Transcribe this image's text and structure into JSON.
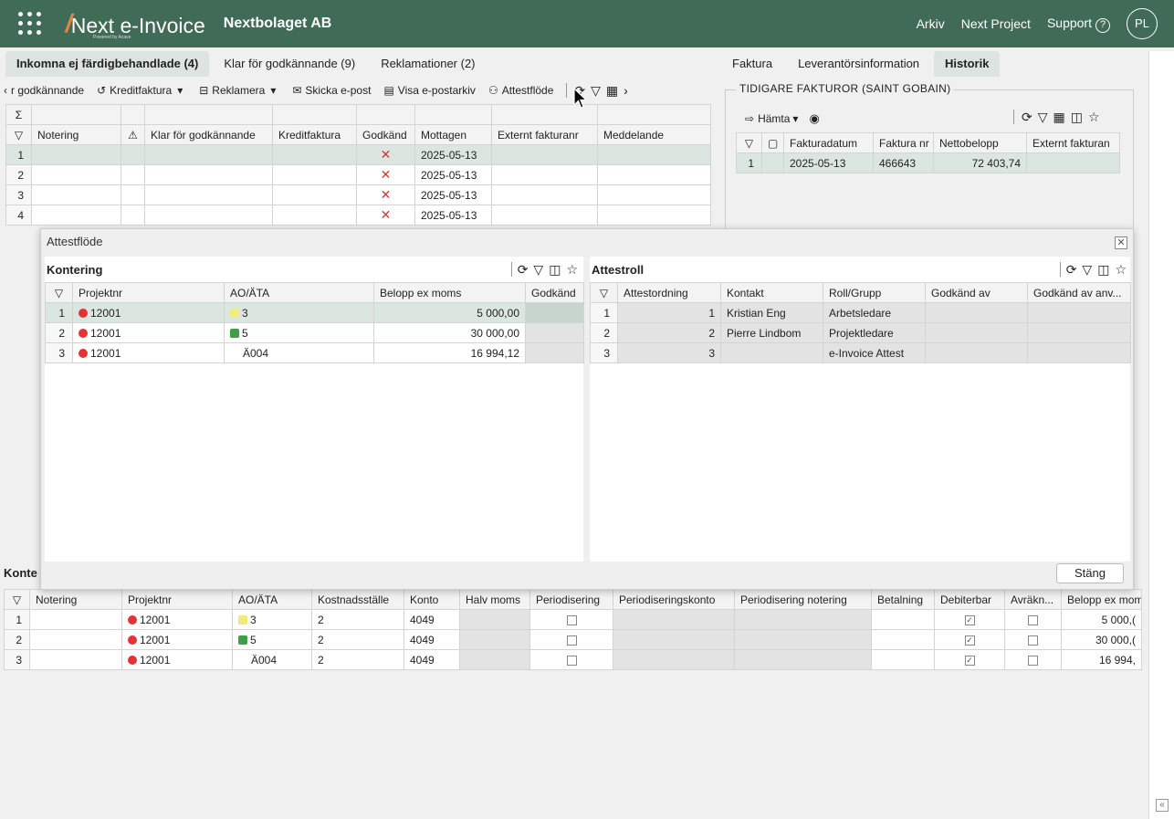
{
  "header": {
    "brand": "Next e-Invoice",
    "powered": "Powered by Acave",
    "company": "Nextbolaget AB",
    "links": [
      "Arkiv",
      "Next Project",
      "Support"
    ],
    "avatar": "PL"
  },
  "left_tabs": [
    "Inkomna ej färdigbehandlade (4)",
    "Klar för godkännande (9)",
    "Reklamationer (2)"
  ],
  "right_tabs": [
    "Faktura",
    "Leverantörsinformation",
    "Historik"
  ],
  "toolbar": {
    "items": [
      "r godkännande",
      "Kreditfaktura",
      "Reklamera",
      "Skicka e-post",
      "Visa e-postarkiv",
      "Attestflöde"
    ]
  },
  "invoice_grid": {
    "headers": [
      "Notering",
      "Klar för godkännande",
      "Kreditfaktura",
      "Godkänd",
      "Mottagen",
      "Externt fakturanr",
      "Meddelande"
    ],
    "rows": [
      {
        "n": "1",
        "date": "2025-05-13"
      },
      {
        "n": "2",
        "date": "2025-05-13"
      },
      {
        "n": "3",
        "date": "2025-05-13"
      },
      {
        "n": "4",
        "date": "2025-05-13"
      }
    ]
  },
  "history": {
    "title": "TIDIGARE FAKTUROR (SAINT GOBAIN)",
    "fetch": "Hämta",
    "headers": [
      "Fakturadatum",
      "Faktura nr",
      "Nettobelopp",
      "Externt fakturan"
    ],
    "rows": [
      {
        "n": "1",
        "date": "2025-05-13",
        "nr": "466643",
        "amount": "72 403,74"
      }
    ]
  },
  "modal": {
    "title": "Attestflöde",
    "close_label": "Stäng",
    "kontering": {
      "title": "Kontering",
      "headers": [
        "Projektnr",
        "AO/ÄTA",
        "Belopp ex moms",
        "Godkänd"
      ],
      "rows": [
        {
          "n": "1",
          "proj": "12001",
          "ao": "3",
          "amount": "5 000,00"
        },
        {
          "n": "2",
          "proj": "12001",
          "ao": "5",
          "amount": "30 000,00"
        },
        {
          "n": "3",
          "proj": "12001",
          "ao": "Ä004",
          "amount": "16 994,12"
        }
      ]
    },
    "attestroll": {
      "title": "Attestroll",
      "headers": [
        "Attestordning",
        "Kontakt",
        "Roll/Grupp",
        "Godkänd av",
        "Godkänd av anv..."
      ],
      "rows": [
        {
          "n": "1",
          "order": "1",
          "contact": "Kristian Eng",
          "role": "Arbetsledare"
        },
        {
          "n": "2",
          "order": "2",
          "contact": "Pierre Lindbom",
          "role": "Projektledare"
        },
        {
          "n": "3",
          "order": "3",
          "contact": "",
          "role": "e-Invoice Attest"
        }
      ]
    }
  },
  "bottom": {
    "title": "Konte",
    "headers": [
      "Notering",
      "Projektnr",
      "AO/ÄTA",
      "Kostnadsställe",
      "Konto",
      "Halv moms",
      "Periodisering",
      "Periodiseringskonto",
      "Periodisering notering",
      "Betalning",
      "Debiterbar",
      "Avräkn...",
      "Belopp ex mom"
    ],
    "rows": [
      {
        "n": "1",
        "proj": "12001",
        "ao": "3",
        "ks": "2",
        "konto": "4049",
        "amount": "5 000,("
      },
      {
        "n": "2",
        "proj": "12001",
        "ao": "5",
        "ks": "2",
        "konto": "4049",
        "amount": "30 000,("
      },
      {
        "n": "3",
        "proj": "12001",
        "ao": "Ä004",
        "ks": "2",
        "konto": "4049",
        "amount": "16 994,"
      }
    ]
  },
  "colors": {
    "header_bg": "#3f6b57",
    "accent": "#e8833a",
    "selected_row": "#dce6e1"
  }
}
